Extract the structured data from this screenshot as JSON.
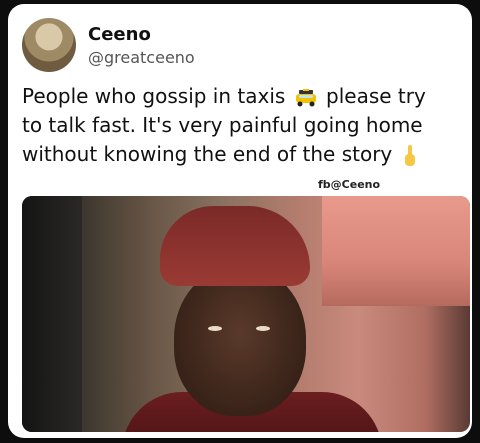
{
  "author": {
    "name": "Ceeno",
    "handle": "@greatceeno"
  },
  "post": {
    "line1_part1": "People who gossip in taxis",
    "line1_part2": "please try",
    "line2": "to talk fast. It's very painful going home",
    "line3": "without knowing the end of the story",
    "taxi_emoji": "taxi-icon",
    "finger_emoji": "index-finger-icon"
  },
  "watermark": "fb@Ceeno",
  "colors": {
    "card_bg": "#ffffff",
    "page_bg": "#0d0d0d",
    "text": "#111111",
    "handle": "#555555"
  }
}
